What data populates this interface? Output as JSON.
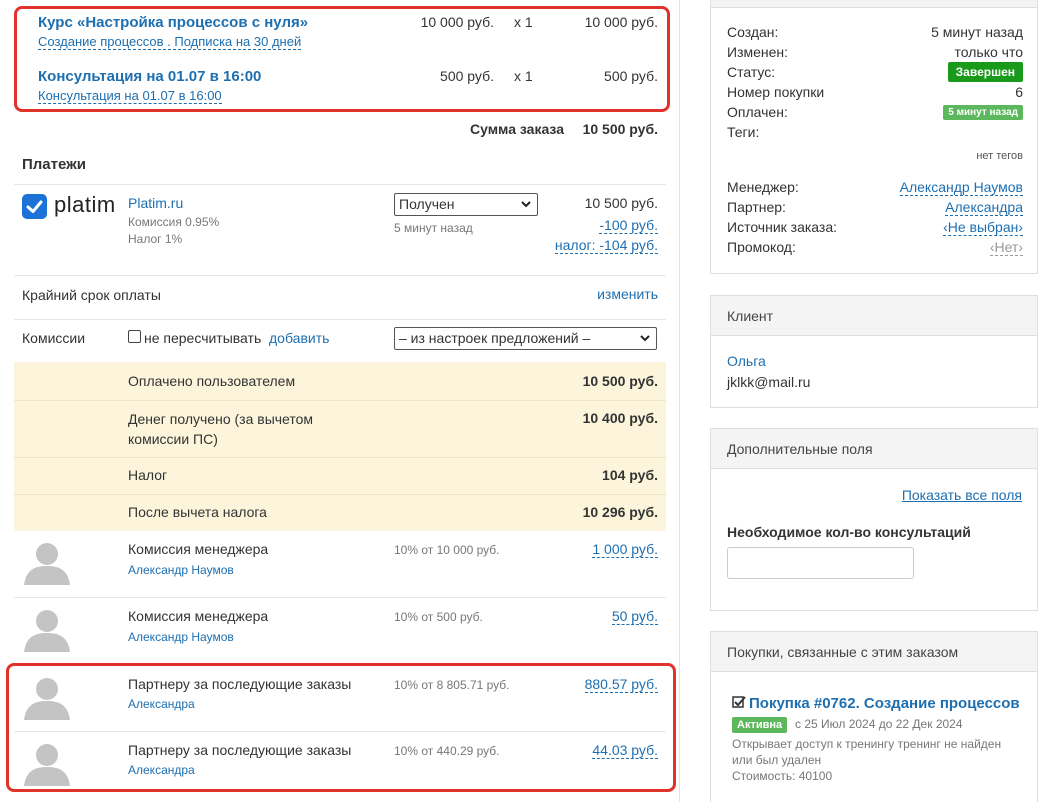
{
  "items": [
    {
      "title": "Курс «Настройка процессов с нуля»",
      "subtitle": "Создание процессов . Подписка на 30 дней",
      "price": "10 000 руб.",
      "qty": "x 1",
      "total": "10 000 руб."
    },
    {
      "title": "Консультация на 01.07 в 16:00",
      "subtitle": "Консультация на 01.07 в 16:00",
      "price": "500 руб.",
      "qty": "x 1",
      "total": "500 руб."
    }
  ],
  "order_sum": {
    "label": "Сумма заказа",
    "value": "10 500 руб."
  },
  "payments": {
    "heading": "Платежи",
    "provider_logo": "platim",
    "provider_link": "Platim.ru",
    "commission": "Комиссия 0.95%",
    "tax": "Налог 1%",
    "status_select": "Получен",
    "status_time": "5 минут назад",
    "amount": "10 500 руб.",
    "fee": "-100 руб.",
    "tax_amount": "налог: -104 руб."
  },
  "deadline": {
    "label": "Крайний срок оплаты",
    "action": "изменить"
  },
  "commissions": {
    "label": "Комиссии",
    "checkbox_label": "не пересчитывать",
    "add_link": "добавить",
    "select_value": "– из настроек предложений –"
  },
  "summary_rows": [
    {
      "label": "Оплачено пользователем",
      "value": "10 500 руб."
    },
    {
      "label": "Денег получено (за вычетом комиссии ПС)",
      "value": "10 400 руб."
    },
    {
      "label": "Налог",
      "value": "104 руб."
    },
    {
      "label": "После вычета налога",
      "value": "10 296 руб."
    }
  ],
  "commission_rows": [
    {
      "title": "Комиссия менеджера",
      "person": "Александр Наумов",
      "calc": "10% от 10 000 руб.",
      "value": "1 000 руб."
    },
    {
      "title": "Комиссия менеджера",
      "person": "Александр Наумов",
      "calc": "10% от 500 руб.",
      "value": "50 руб."
    },
    {
      "title": "Партнеру за последующие заказы",
      "person": "Александра",
      "calc": "10% от 8 805.71 руб.",
      "value": "880.57 руб."
    },
    {
      "title": "Партнеру за последующие заказы",
      "person": "Александра",
      "calc": "10% от 440.29 руб.",
      "value": "44.03 руб."
    }
  ],
  "info": {
    "created_label": "Создан:",
    "created_value": "5 минут назад",
    "changed_label": "Изменен:",
    "changed_value": "только что",
    "status_label": "Статус:",
    "status_value": "Завершен",
    "number_label": "Номер покупки",
    "number_value": "6",
    "paid_label": "Оплачен:",
    "paid_value": "5 минут назад",
    "tags_label": "Теги:",
    "tags_value": "нет тегов",
    "manager_label": "Менеджер:",
    "manager_value": "Александр Наумов",
    "partner_label": "Партнер:",
    "partner_value": "Александра",
    "source_label": "Источник заказа:",
    "source_value": "‹Не выбран›",
    "promo_label": "Промокод:",
    "promo_value": "‹Нет›"
  },
  "client": {
    "heading": "Клиент",
    "name": "Ольга",
    "email": "jklkk@mail.ru"
  },
  "extra_fields": {
    "heading": "Дополнительные поля",
    "show_all": "Показать все поля",
    "field_label": "Необходимое кол-во консультаций",
    "field_value": ""
  },
  "related": {
    "heading": "Покупки, связанные с этим заказом",
    "purchase_title": "Покупка #0762. Создание процессов",
    "badge": "Активна",
    "period": "с 25 Июл 2024 до 22 Дек 2024",
    "description": "Открывает доступ к тренингу тренинг не найден или был удален",
    "cost": "Стоимость: 40100"
  },
  "colors": {
    "accent": "#1e6fb0",
    "highlight": "#e0342b",
    "summary_bg": "#fcf5dc",
    "status_green": "#1a9a1a"
  }
}
